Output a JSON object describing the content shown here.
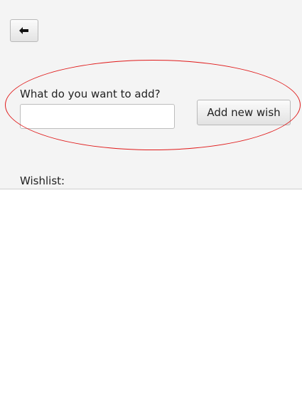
{
  "header": {
    "back_icon": "arrow-left-icon"
  },
  "form": {
    "prompt_label": "What do you want to add?",
    "input_value": "",
    "input_placeholder": "",
    "add_button_label": "Add new wish"
  },
  "wishlist": {
    "label": "Wishlist:",
    "items": []
  },
  "annotation": {
    "color": "#e01a1a"
  }
}
